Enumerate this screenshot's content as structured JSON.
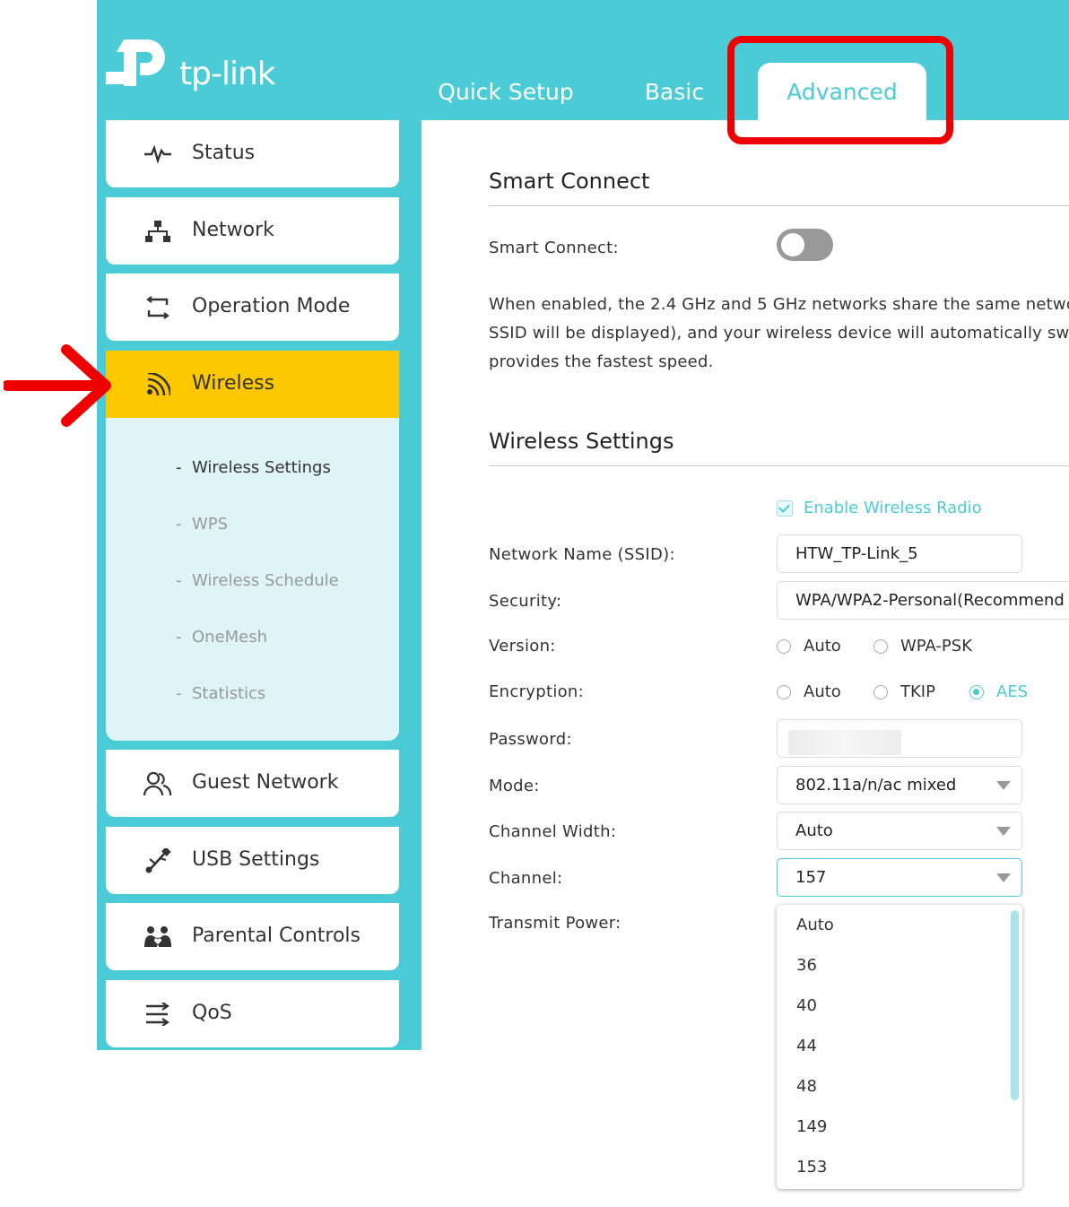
{
  "brand": {
    "logo_text": "tp-link",
    "accent": "#4acbd6",
    "highlight": "#fdc800",
    "annotation": "#ee0000"
  },
  "tabs": [
    {
      "label": "Quick Setup",
      "active": false
    },
    {
      "label": "Basic",
      "active": false
    },
    {
      "label": "Advanced",
      "active": true
    }
  ],
  "sidebar": {
    "items": [
      {
        "label": "Status",
        "icon": "pulse-icon"
      },
      {
        "label": "Network",
        "icon": "network-icon"
      },
      {
        "label": "Operation Mode",
        "icon": "operation-mode-icon"
      },
      {
        "label": "Wireless",
        "icon": "wifi-icon",
        "active": true
      },
      {
        "label": "Guest Network",
        "icon": "users-icon"
      },
      {
        "label": "USB Settings",
        "icon": "usb-icon"
      },
      {
        "label": "Parental Controls",
        "icon": "family-icon"
      },
      {
        "label": "QoS",
        "icon": "qos-icon"
      }
    ],
    "submenu": [
      {
        "label": "Wireless Settings",
        "active": true
      },
      {
        "label": "WPS"
      },
      {
        "label": "Wireless Schedule"
      },
      {
        "label": "OneMesh"
      },
      {
        "label": "Statistics"
      }
    ]
  },
  "smart_connect": {
    "title": "Smart Connect",
    "label": "Smart Connect:",
    "enabled": false,
    "description": [
      "When enabled, the 2.4 GHz and 5 GHz networks share the same netwo",
      "SSID will be displayed), and your wireless device will automatically swit",
      "provides the fastest speed."
    ]
  },
  "wireless_settings": {
    "title": "Wireless Settings",
    "enable_radio": "Enable Wireless Radio",
    "labels": {
      "ssid": "Network Name (SSID):",
      "security": "Security:",
      "version": "Version:",
      "encryption": "Encryption:",
      "password": "Password:",
      "mode": "Mode:",
      "channel_width": "Channel Width:",
      "channel": "Channel:",
      "transmit_power": "Transmit Power:"
    },
    "ssid": "HTW_TP-Link_5",
    "security": "WPA/WPA2-Personal(Recommend",
    "version_options": [
      "Auto",
      "WPA-PSK"
    ],
    "encryption_options": [
      "Auto",
      "TKIP",
      "AES"
    ],
    "encryption_selected": "AES",
    "mode": "802.11a/n/ac mixed",
    "channel_width": "Auto",
    "channel": "157",
    "channel_options": [
      "Auto",
      "36",
      "40",
      "44",
      "48",
      "149",
      "153"
    ]
  }
}
